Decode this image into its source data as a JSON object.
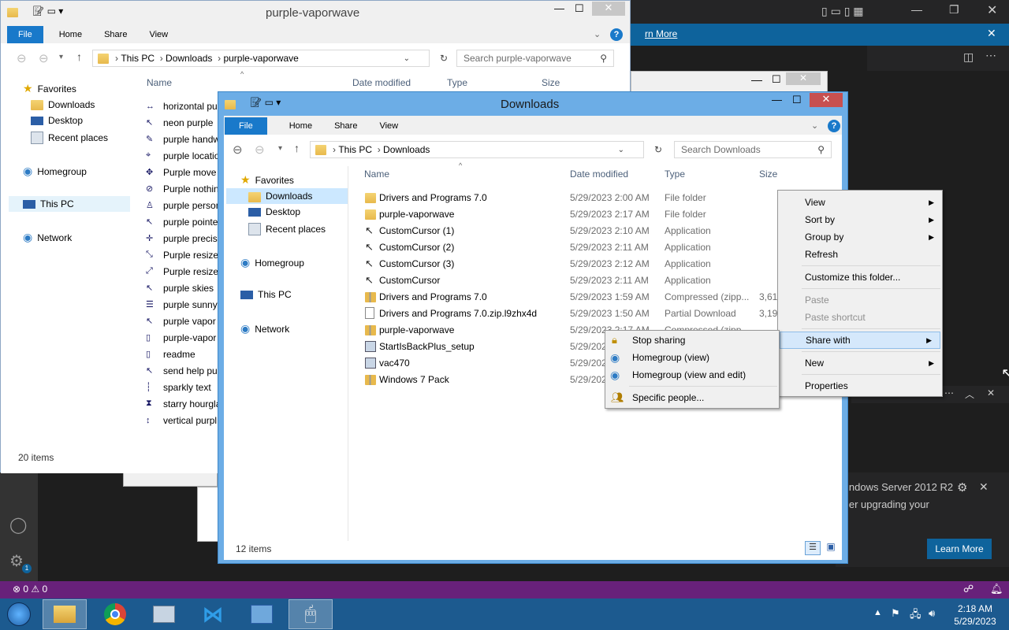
{
  "vscode": {
    "banner_link": "rn More",
    "notification_line1": "indows Server 2012 R2",
    "notification_line2": "ler upgrading your",
    "learn_more": "Learn More",
    "status_problems": "⊗ 0 ⚠ 0",
    "badge": "1"
  },
  "back_window": {
    "title": "purple-vaporwave",
    "tabs": [
      "File",
      "Home",
      "Share",
      "View"
    ],
    "breadcrumb": [
      "This PC",
      "Downloads",
      "purple-vaporwave"
    ],
    "search_placeholder": "Search purple-vaporwave",
    "columns": [
      "Name",
      "Date modified",
      "Type",
      "Size"
    ],
    "nav": [
      "Favorites",
      "Downloads",
      "Desktop",
      "Recent places",
      "Homegroup",
      "This PC",
      "Network"
    ],
    "files": [
      "horizontal pu",
      "neon purple",
      "purple handw",
      "purple locatio",
      "Purple move",
      "Purple nothin",
      "purple person",
      "purple pointe",
      "purple precis",
      "Purple resize",
      "Purple resize",
      "purple skies",
      "purple sunny",
      "purple vapor",
      "purple-vapor",
      "readme",
      "send help pur",
      "sparkly text",
      "starry hourgla",
      "vertical purpl"
    ],
    "status": "20 items"
  },
  "front_window": {
    "title": "Downloads",
    "tabs": [
      "File",
      "Home",
      "Share",
      "View"
    ],
    "breadcrumb": [
      "This PC",
      "Downloads"
    ],
    "search_placeholder": "Search Downloads",
    "columns": [
      "Name",
      "Date modified",
      "Type",
      "Size"
    ],
    "nav": [
      "Favorites",
      "Downloads",
      "Desktop",
      "Recent places",
      "Homegroup",
      "This PC",
      "Network"
    ],
    "files": [
      {
        "name": "Drivers and Programs 7.0",
        "date": "5/29/2023 2:00 AM",
        "type": "File folder",
        "size": "",
        "icon": "folder-icon"
      },
      {
        "name": "purple-vaporwave",
        "date": "5/29/2023 2:17 AM",
        "type": "File folder",
        "size": "",
        "icon": "folder-icon"
      },
      {
        "name": "CustomCursor (1)",
        "date": "5/29/2023 2:10 AM",
        "type": "Application",
        "size": "",
        "icon": "cursor-app-icon"
      },
      {
        "name": "CustomCursor (2)",
        "date": "5/29/2023 2:11 AM",
        "type": "Application",
        "size": "",
        "icon": "cursor-app-icon"
      },
      {
        "name": "CustomCursor (3)",
        "date": "5/29/2023 2:12 AM",
        "type": "Application",
        "size": "",
        "icon": "cursor-app-icon"
      },
      {
        "name": "CustomCursor",
        "date": "5/29/2023 2:11 AM",
        "type": "Application",
        "size": "",
        "icon": "cursor-app-icon"
      },
      {
        "name": "Drivers and Programs 7.0",
        "date": "5/29/2023 1:59 AM",
        "type": "Compressed (zipp...",
        "size": "3,61",
        "icon": "zip-folder-icon"
      },
      {
        "name": "Drivers and Programs 7.0.zip.l9zhx4d",
        "date": "5/29/2023 1:50 AM",
        "type": "Partial Download",
        "size": "3,19",
        "icon": "partial-download-icon"
      },
      {
        "name": "purple-vaporwave",
        "date": "5/29/2023 2:17 AM",
        "type": "Compressed (zipp...",
        "size": "",
        "icon": "zip-folder-icon"
      },
      {
        "name": "StartIsBackPlus_setup",
        "date": "5/29/2023",
        "type": "",
        "size": "",
        "icon": "setup-icon"
      },
      {
        "name": "vac470",
        "date": "5/29/2023",
        "type": "",
        "size": "",
        "icon": "exe-icon"
      },
      {
        "name": "Windows 7 Pack",
        "date": "5/29/2023",
        "type": "",
        "size": "",
        "icon": "zip-folder-icon"
      }
    ],
    "status": "12 items"
  },
  "context_menu": {
    "view": "View",
    "sort_by": "Sort by",
    "group_by": "Group by",
    "refresh": "Refresh",
    "customize": "Customize this folder...",
    "paste": "Paste",
    "paste_shortcut": "Paste shortcut",
    "share_with": "Share with",
    "new": "New",
    "properties": "Properties"
  },
  "share_submenu": {
    "stop_sharing": "Stop sharing",
    "homegroup_view": "Homegroup (view)",
    "homegroup_view_edit": "Homegroup (view and edit)",
    "specific_people": "Specific people..."
  },
  "tray": {
    "time": "2:18 AM",
    "date": "5/29/2023"
  },
  "colors": {
    "title_active": "#6cade6",
    "vscode_status": "#68217a",
    "taskbar": "#1c5a8f",
    "file_tab": "#1979ca"
  }
}
